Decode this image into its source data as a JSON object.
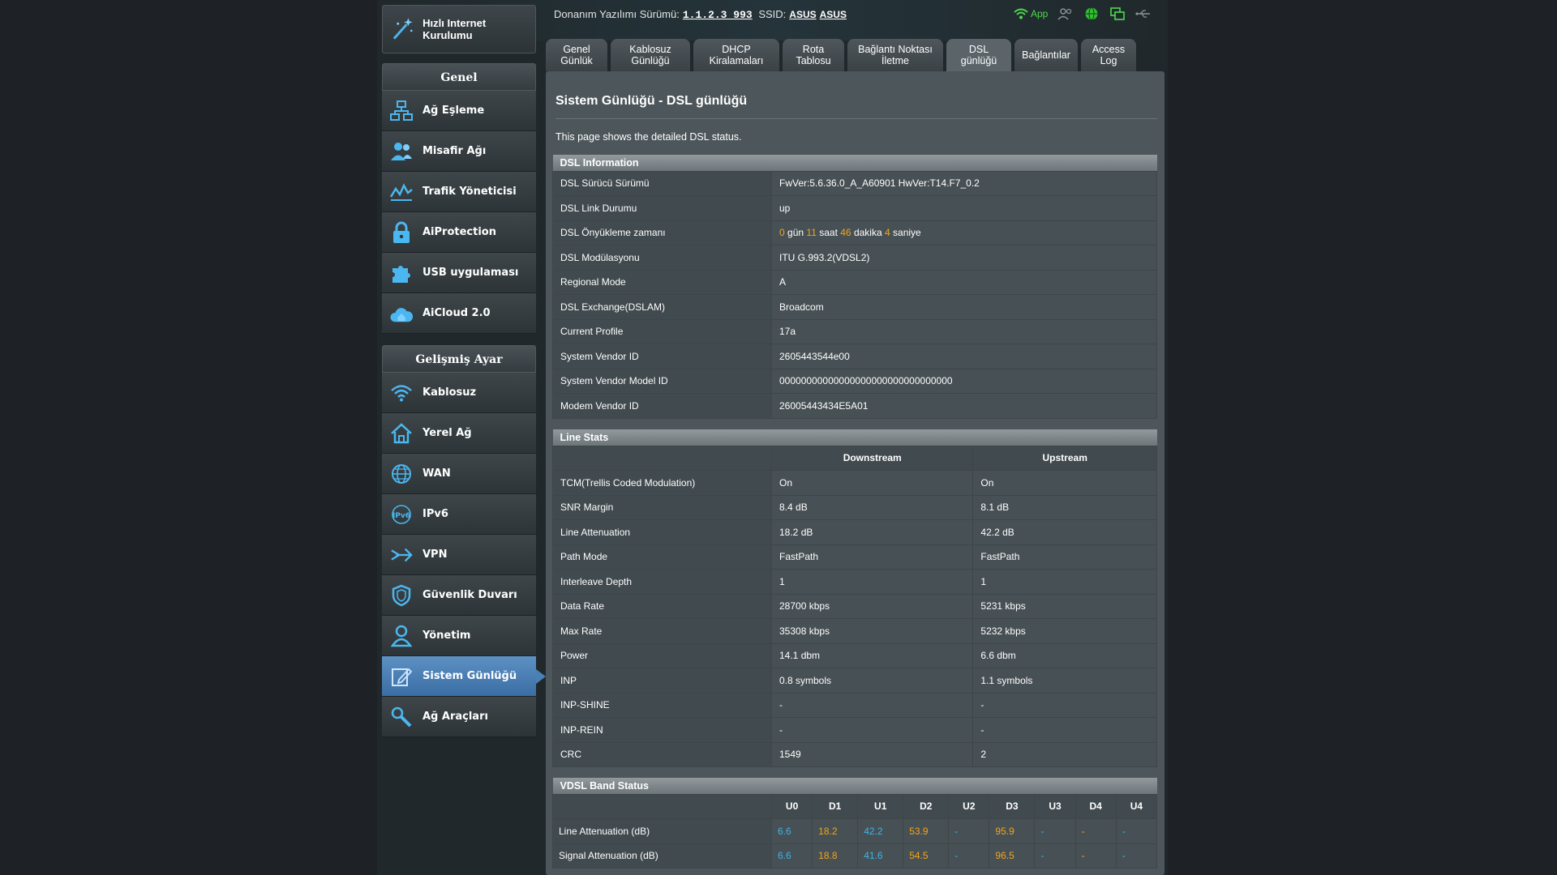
{
  "header": {
    "firmware_label": "Donanım Yazılımı Sürümü:",
    "firmware_version": "1.1.2.3_993",
    "ssid_label": "SSID:",
    "ssid_1": "ASUS",
    "ssid_2": "ASUS",
    "app_label": "App"
  },
  "sidebar": {
    "qis_label": "Hızlı Internet Kurulumu",
    "general_title": "Genel",
    "general_items": [
      "Ağ Eşleme",
      "Misafir Ağı",
      "Trafik Yöneticisi",
      "AiProtection",
      "USB uygulaması",
      "AiCloud 2.0"
    ],
    "advanced_title": "Gelişmiş Ayar",
    "advanced_items": [
      "Kablosuz",
      "Yerel Ağ",
      "WAN",
      "IPv6",
      "VPN",
      "Güvenlik Duvarı",
      "Yönetim",
      "Sistem Günlüğü",
      "Ağ Araçları"
    ]
  },
  "tabs": [
    "Genel Günlük",
    "Kablosuz Günlüğü",
    "DHCP Kiralamaları",
    "Rota Tablosu",
    "Bağlantı Noktası İletme",
    "DSL günlüğü",
    "Bağlantılar",
    "Access Log"
  ],
  "page": {
    "title": "Sistem Günlüğü - DSL günlüğü",
    "description": "This page shows the detailed DSL status."
  },
  "dsl_info": {
    "title": "DSL Information",
    "rows": [
      [
        "DSL Sürücü Sürümü",
        "FwVer:5.6.36.0_A_A60901 HwVer:T14.F7_0.2"
      ],
      [
        "DSL Link Durumu",
        "up"
      ],
      [
        "DSL Önyükleme zamanı",
        ""
      ],
      [
        "DSL Modülasyonu",
        "ITU G.993.2(VDSL2)"
      ],
      [
        "Regional Mode",
        "A"
      ],
      [
        "DSL Exchange(DSLAM)",
        "Broadcom"
      ],
      [
        "Current Profile",
        "17a"
      ],
      [
        "System Vendor ID",
        "2605443544e00"
      ],
      [
        "System Vendor Model ID",
        "00000000000000000000000000000000"
      ],
      [
        "Modem Vendor ID",
        "26005443434E5A01"
      ]
    ],
    "uptime": {
      "days": "0",
      "days_label": "gün",
      "hours": "11",
      "hours_label": "saat",
      "minutes": "46",
      "minutes_label": "dakika",
      "seconds": "4",
      "seconds_label": "saniye"
    }
  },
  "line_stats": {
    "title": "Line Stats",
    "columns": [
      "Downstream",
      "Upstream"
    ],
    "rows": [
      [
        "TCM(Trellis Coded Modulation)",
        "On",
        "On"
      ],
      [
        "SNR Margin",
        "8.4 dB",
        "8.1 dB"
      ],
      [
        "Line Attenuation",
        "18.2 dB",
        "42.2 dB"
      ],
      [
        "Path Mode",
        "FastPath",
        "FastPath"
      ],
      [
        "Interleave Depth",
        "1",
        "1"
      ],
      [
        "Data Rate",
        "28700 kbps",
        "5231 kbps"
      ],
      [
        "Max Rate",
        "35308 kbps",
        "5232 kbps"
      ],
      [
        "Power",
        "14.1 dbm",
        "6.6 dbm"
      ],
      [
        "INP",
        "0.8 symbols",
        "1.1 symbols"
      ],
      [
        "INP-SHINE",
        "-",
        "-"
      ],
      [
        "INP-REIN",
        "-",
        "-"
      ],
      [
        "CRC",
        "1549",
        "2"
      ]
    ]
  },
  "vdsl_band": {
    "title": "VDSL Band Status",
    "columns": [
      "U0",
      "D1",
      "U1",
      "D2",
      "U2",
      "D3",
      "U3",
      "D4",
      "U4"
    ],
    "rows": [
      [
        "Line Attenuation (dB)",
        "6.6",
        "18.2",
        "42.2",
        "53.9",
        "-",
        "95.9",
        "-",
        "-",
        "-"
      ],
      [
        "Signal Attenuation (dB)",
        "6.6",
        "18.8",
        "41.6",
        "54.5",
        "-",
        "96.5",
        "-",
        "-",
        "-"
      ]
    ]
  },
  "colors": {
    "upstream": "#3fb3e8",
    "downstream": "#f3a51c",
    "accent": "#4b80b5"
  }
}
